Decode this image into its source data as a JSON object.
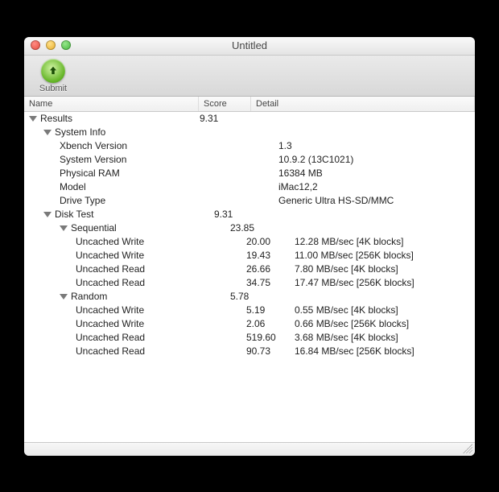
{
  "window": {
    "title": "Untitled"
  },
  "toolbar": {
    "submit_label": "Submit"
  },
  "columns": {
    "name": "Name",
    "score": "Score",
    "detail": "Detail"
  },
  "rows": [
    {
      "depth": 1,
      "expandable": true,
      "name": "Results",
      "score": "9.31",
      "detail": ""
    },
    {
      "depth": 2,
      "expandable": true,
      "name": "System Info",
      "score": "",
      "detail": ""
    },
    {
      "depth": 3,
      "expandable": false,
      "name": "Xbench Version",
      "score": "",
      "detail": "1.3"
    },
    {
      "depth": 3,
      "expandable": false,
      "name": "System Version",
      "score": "",
      "detail": "10.9.2 (13C1021)"
    },
    {
      "depth": 3,
      "expandable": false,
      "name": "Physical RAM",
      "score": "",
      "detail": "16384 MB"
    },
    {
      "depth": 3,
      "expandable": false,
      "name": "Model",
      "score": "",
      "detail": "iMac12,2"
    },
    {
      "depth": 3,
      "expandable": false,
      "name": "Drive Type",
      "score": "",
      "detail": "Generic Ultra HS-SD/MMC"
    },
    {
      "depth": 2,
      "expandable": true,
      "name": "Disk Test",
      "score": "9.31",
      "detail": ""
    },
    {
      "depth": 3,
      "expandable": true,
      "name": "Sequential",
      "score": "23.85",
      "detail": ""
    },
    {
      "depth": 4,
      "expandable": false,
      "name": "Uncached Write",
      "score": "20.00",
      "detail": "12.28 MB/sec [4K blocks]"
    },
    {
      "depth": 4,
      "expandable": false,
      "name": "Uncached Write",
      "score": "19.43",
      "detail": "11.00 MB/sec [256K blocks]"
    },
    {
      "depth": 4,
      "expandable": false,
      "name": "Uncached Read",
      "score": "26.66",
      "detail": "7.80 MB/sec [4K blocks]"
    },
    {
      "depth": 4,
      "expandable": false,
      "name": "Uncached Read",
      "score": "34.75",
      "detail": "17.47 MB/sec [256K blocks]"
    },
    {
      "depth": 3,
      "expandable": true,
      "name": "Random",
      "score": "5.78",
      "detail": ""
    },
    {
      "depth": 4,
      "expandable": false,
      "name": "Uncached Write",
      "score": "5.19",
      "detail": "0.55 MB/sec [4K blocks]"
    },
    {
      "depth": 4,
      "expandable": false,
      "name": "Uncached Write",
      "score": "2.06",
      "detail": "0.66 MB/sec [256K blocks]"
    },
    {
      "depth": 4,
      "expandable": false,
      "name": "Uncached Read",
      "score": "519.60",
      "detail": "3.68 MB/sec [4K blocks]"
    },
    {
      "depth": 4,
      "expandable": false,
      "name": "Uncached Read",
      "score": "90.73",
      "detail": "16.84 MB/sec [256K blocks]"
    }
  ]
}
